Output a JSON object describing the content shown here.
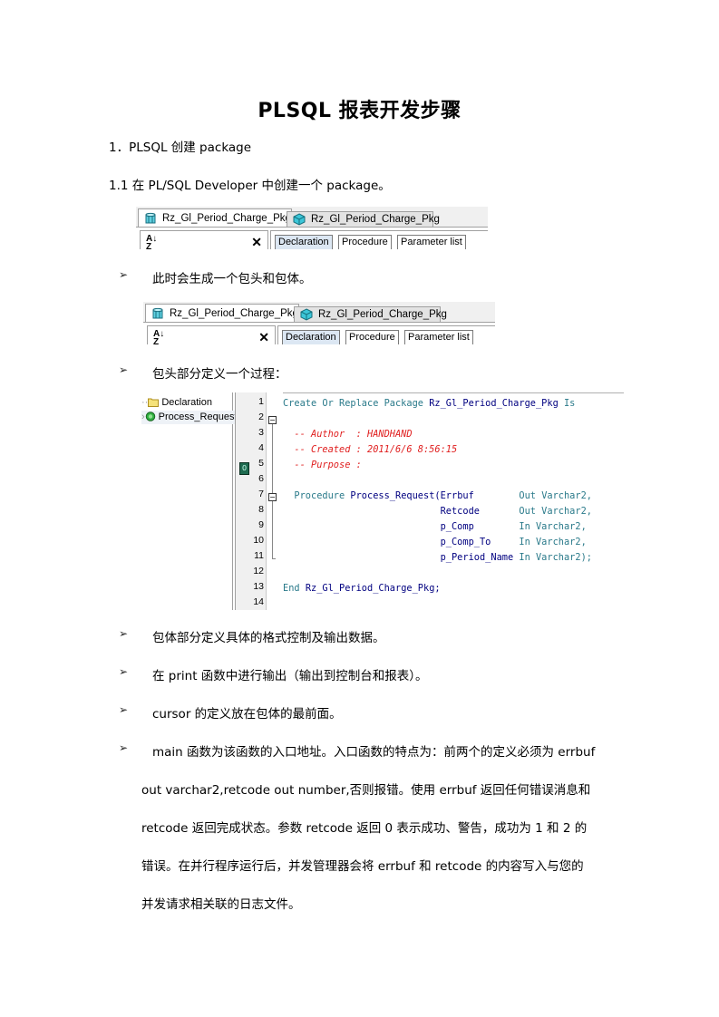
{
  "document": {
    "title": "PLSQL 报表开发步骤",
    "section1": "1．PLSQL 创建 package",
    "section1_1": "1.1  在 PL/SQL Developer 中创建一个 package。",
    "bullet_glyph": "➢",
    "bullets": [
      "此时会生成一个包头和包体。",
      "包头部分定义一个过程：",
      "包体部分定义具体的格式控制及输出数据。",
      "在 print 函数中进行输出（输出到控制台和报表）。",
      "cursor 的定义放在包体的最前面。",
      "main 函数为该函数的入口地址。入口函数的特点为：前两个的定义必须为 errbuf"
    ],
    "paragraph_lines": [
      "out varchar2,retcode out number,否则报错。使用  errbuf  返回任何错误消息和",
      "retcode  返回完成状态。参数  retcode  返回  0  表示成功、警告，成功为  1  和  2  的",
      "错误。在并行程序运行后，并发管理器会将  errbuf  和  retcode  的内容写入与您的",
      "并发请求相关联的日志文件。"
    ]
  },
  "screenshot1": {
    "tabs": [
      {
        "label": "Rz_Gl_Period_Charge_Pkg",
        "icon": "package-spec-icon",
        "active": true
      },
      {
        "label": "Rz_Gl_Period_Charge_Pkg",
        "icon": "package-body-icon",
        "active": false
      }
    ],
    "sort_icon": "A↓Z",
    "close_glyph": "✕",
    "buttons": [
      "Declaration",
      "Procedure",
      "Parameter list"
    ],
    "active_button": "Declaration"
  },
  "screenshot2": {
    "tabs": [
      {
        "label": "Rz_Gl_Period_Charge_Pkg",
        "icon": "package-spec-icon",
        "active": true
      },
      {
        "label": "Rz_Gl_Period_Charge_Pkg",
        "icon": "package-body-icon",
        "active": false
      }
    ],
    "sort_icon": "A↓Z",
    "close_glyph": "✕",
    "buttons": [
      "Declaration",
      "Procedure",
      "Parameter list"
    ],
    "active_button": "Declaration"
  },
  "editor": {
    "tree": [
      {
        "label": "Declaration",
        "icon": "folder-icon"
      },
      {
        "label": "Process_Request",
        "icon": "procedure-icon"
      }
    ],
    "line_numbers": [
      "1",
      "2",
      "3",
      "4",
      "5",
      "6",
      "7",
      "8",
      "9",
      "10",
      "11",
      "12",
      "13",
      "14"
    ],
    "bookmark_line": "5",
    "bookmark_glyph": "0",
    "fold_lines": [
      "2",
      "7"
    ],
    "code_lines": [
      [
        {
          "t": "Create Or Replace Package ",
          "c": "kw"
        },
        {
          "t": "Rz_Gl_Period_Charge_Pkg ",
          "c": "id"
        },
        {
          "t": "Is",
          "c": "kw"
        }
      ],
      [],
      [
        {
          "t": "  -- Author  : HANDHAND",
          "c": "cm"
        }
      ],
      [
        {
          "t": "  -- Created : 2011/6/6 8:56:15",
          "c": "cm"
        }
      ],
      [
        {
          "t": "  -- Purpose :",
          "c": "cm"
        }
      ],
      [],
      [
        {
          "t": "  Procedure ",
          "c": "kw"
        },
        {
          "t": "Process_Request(Errbuf        ",
          "c": "id"
        },
        {
          "t": "Out Varchar2,",
          "c": "kw"
        }
      ],
      [
        {
          "t": "                            Retcode       ",
          "c": "id"
        },
        {
          "t": "Out Varchar2,",
          "c": "kw"
        }
      ],
      [
        {
          "t": "                            p_Comp        ",
          "c": "id"
        },
        {
          "t": "In Varchar2,",
          "c": "kw"
        }
      ],
      [
        {
          "t": "                            p_Comp_To     ",
          "c": "id"
        },
        {
          "t": "In Varchar2,",
          "c": "kw"
        }
      ],
      [
        {
          "t": "                            p_Period_Name ",
          "c": "id"
        },
        {
          "t": "In Varchar2);",
          "c": "kw"
        }
      ],
      [],
      [
        {
          "t": "End ",
          "c": "kw"
        },
        {
          "t": "Rz_Gl_Period_Charge_Pkg;",
          "c": "id"
        }
      ],
      []
    ]
  }
}
